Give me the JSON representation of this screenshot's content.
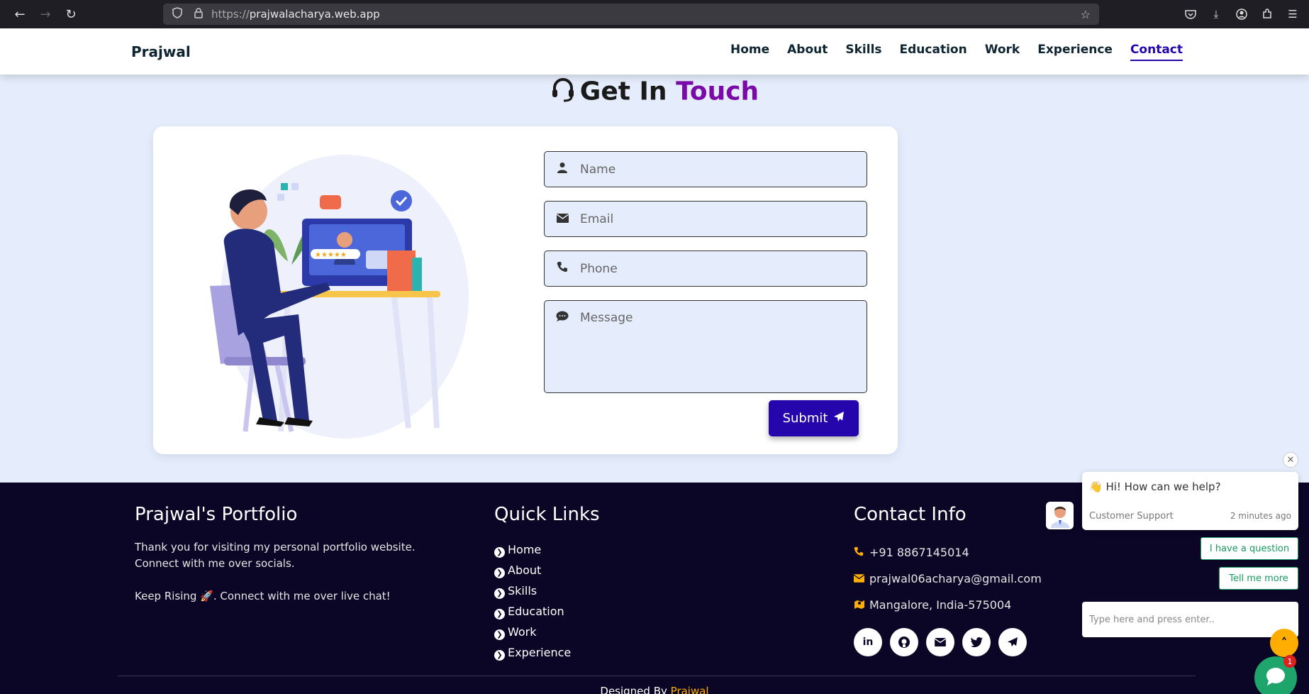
{
  "browser": {
    "url_prefix": "https://",
    "url_domain": "prajwalacharya.web.app",
    "icons": [
      "back-icon",
      "forward-icon",
      "reload-icon",
      "shield-icon",
      "lock-icon",
      "bookmark-star-icon",
      "pocket-icon",
      "download-icon",
      "account-icon",
      "extensions-icon",
      "menu-icon"
    ]
  },
  "header": {
    "brand": "Prajwal",
    "menu": [
      {
        "label": "Home"
      },
      {
        "label": "About"
      },
      {
        "label": "Skills"
      },
      {
        "label": "Education"
      },
      {
        "label": "Work"
      },
      {
        "label": "Experience"
      },
      {
        "label": "Contact",
        "active": true
      }
    ]
  },
  "contact": {
    "heading_part1": "Get In",
    "heading_part2": "Touch",
    "name_placeholder": "Name",
    "email_placeholder": "Email",
    "phone_placeholder": "Phone",
    "message_placeholder": "Message",
    "submit_label": "Submit"
  },
  "footer": {
    "portfolio_title": "Prajwal's Portfolio",
    "portfolio_text1": "Thank you for visiting my personal portfolio website. Connect with me over socials.",
    "portfolio_text2": "Keep Rising 🚀. Connect with me over live chat!",
    "quick_links_title": "Quick Links",
    "quick_links": [
      "Home",
      "About",
      "Skills",
      "Education",
      "Work",
      "Experience"
    ],
    "contact_title": "Contact Info",
    "phone": "+91 8867145014",
    "email": "prajwal06acharya@gmail.com",
    "address": "Mangalore, India-575004",
    "socials": [
      "linkedin-icon",
      "github-icon",
      "mail-icon",
      "twitter-icon",
      "telegram-icon"
    ],
    "credit_prefix": "Designed By",
    "credit_name": "Prajwal"
  },
  "chat": {
    "message": "👋 Hi! How can we help?",
    "agent": "Customer Support",
    "time": "2 minutes ago",
    "option1": "I have a question",
    "option2": "Tell me more",
    "input_placeholder": "Type here and press enter..",
    "badge_count": "1"
  },
  "colors": {
    "accent": "#2506ad",
    "heading_highlight": "#7b0ba8",
    "footer_bg": "#0b0526",
    "footer_accent": "#ffae00",
    "page_bg": "#e5ecfb",
    "chat_green": "#1ea56b"
  }
}
